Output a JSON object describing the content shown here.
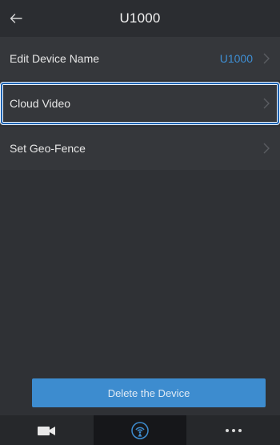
{
  "header": {
    "title": "U1000",
    "back_icon": "arrow-left-icon"
  },
  "settings": [
    {
      "label": "Edit Device Name",
      "value": "U1000",
      "icon": "chevron-right-icon"
    },
    {
      "label": "Cloud Video",
      "value": "",
      "icon": "chevron-right-icon",
      "selected": true
    },
    {
      "label": "Set Geo-Fence",
      "value": "",
      "icon": "chevron-right-icon"
    }
  ],
  "actions": {
    "delete_label": "Delete the Device"
  },
  "tabbar": {
    "tabs": [
      {
        "icon": "video-camera-icon",
        "active": false
      },
      {
        "icon": "wireless-signal-icon",
        "active": true
      },
      {
        "icon": "more-dots-icon",
        "active": false
      }
    ]
  },
  "colors": {
    "accent": "#3d8ccf",
    "value_text": "#3e8fd4",
    "background": "#2f3135",
    "row": "#35373b",
    "active_tab": "#16171a"
  }
}
